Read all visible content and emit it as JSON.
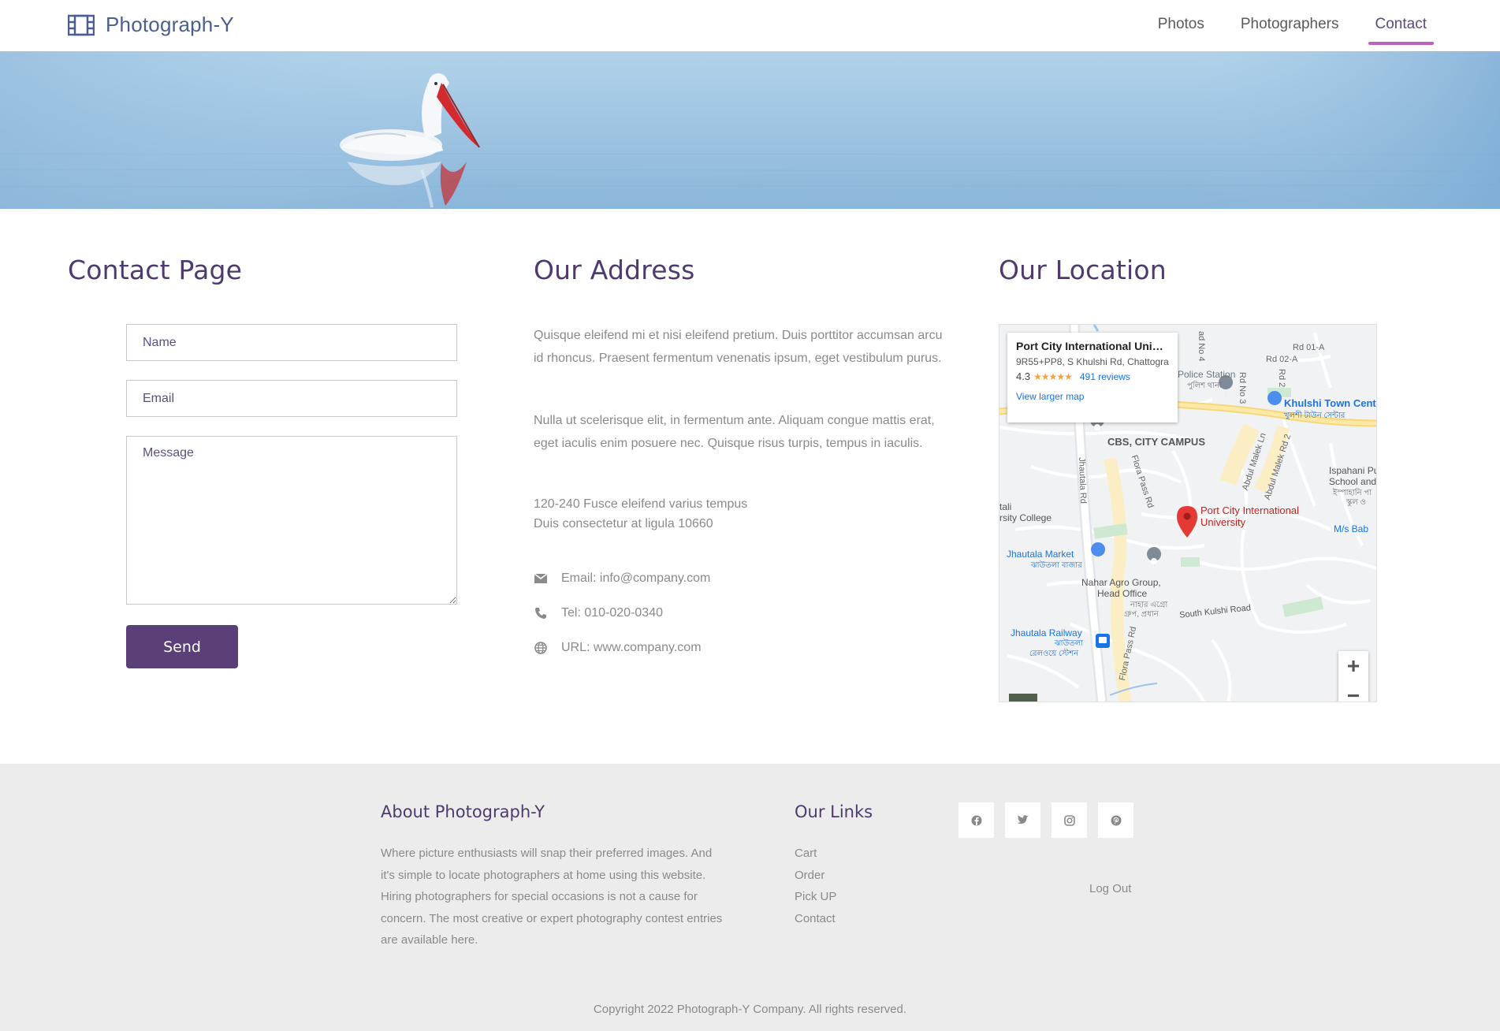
{
  "navbar": {
    "brand": "Photograph-Y",
    "brand_icon": "film-icon",
    "links": [
      {
        "label": "Photos"
      },
      {
        "label": "Photographers"
      },
      {
        "label": "Contact",
        "active": true
      }
    ],
    "active_color": "#b962c0"
  },
  "contact": {
    "title": "Contact Page",
    "name_placeholder": "Name",
    "email_placeholder": "Email",
    "message_placeholder": "Message",
    "send_label": "Send",
    "button_color": "#5a3f78"
  },
  "address": {
    "title": "Our Address",
    "paragraph1": "Quisque eleifend mi et nisi eleifend pretium. Duis porttitor accumsan arcu id rhoncus. Praesent fermentum venenatis ipsum, eget vestibulum purus.",
    "paragraph2": "Nulla ut scelerisque elit, in fermentum ante. Aliquam congue mattis erat, eget iaculis enim posuere nec. Quisque risus turpis, tempus in iaculis.",
    "line1": "120-240 Fusce eleifend varius tempus",
    "line2": "Duis consectetur at ligula 10660",
    "email": "Email: info@company.com",
    "tel": "Tel: 010-020-0340",
    "url": "URL: www.company.com"
  },
  "location": {
    "title": "Our Location",
    "card_title": "Port City International Univers...",
    "card_address": "9R55+PP8, S Khulshi Rd, Chattogram",
    "card_rating": "4.3",
    "card_stars": "★★★★★",
    "card_reviews": "491 reviews",
    "card_link": "View larger map",
    "zoom_in": "+",
    "zoom_out": "−",
    "labels": {
      "police": "Police Station",
      "police_bn": "পুলিশ থানা",
      "rd01a": "Rd 01-A",
      "rd02a": "Rd 02-A",
      "rd_no4": "ad No 4",
      "rd_no3": "Rd No 3",
      "rd2": "Rd 2",
      "khulshi": "Khulshi Town Cent",
      "khulshi_bn": "খুলশী টাউন সেন্টার",
      "cbs": "CBS, CITY CAMPUS",
      "abdul1": "Abdul Malek Ln",
      "abdul2": "Abdul Malek Rd 2",
      "ispahani1": "Ispahani Pu",
      "ispahani2": "School and Col",
      "ispahani_bn1": "ইস্পাহানি পা",
      "ispahani_bn2": "স্কুল ও",
      "jhautala_rd": "Jhautala Rd",
      "flora1": "Flora Pass Rd",
      "college1": "tali",
      "college2": "rsity College",
      "port1": "Port City International",
      "port2": "University",
      "msbab": "M/s Bab",
      "market": "Jhautala Market",
      "market_bn": "ঝাউতলা বাজার",
      "nahar1": "Nahar Agro Group,",
      "nahar2": "Head Office",
      "nahar_bn1": "নাহার এগ্রো",
      "nahar_bn2": "গ্রুপ, প্রধান",
      "south_kulshi": "South Kulshi Road",
      "railway": "Jhautala Railway",
      "railway_bn1": "ঝাউতলা",
      "railway_bn2": "রেলওয়ে স্টেশন",
      "flora2": "Flora Pass Rd"
    }
  },
  "footer": {
    "about_title": "About Photograph-Y",
    "about_text": "Where picture enthusiasts will snap their preferred images. And it's simple to locate photographers at home using this website. Hiring photographers for special occasions is not a cause for concern. The most creative or expert photography contest entries are available here.",
    "links_title": "Our Links",
    "links": [
      {
        "label": "Cart"
      },
      {
        "label": "Order"
      },
      {
        "label": "Pick UP"
      },
      {
        "label": "Contact"
      }
    ],
    "social": [
      "facebook-icon",
      "twitter-icon",
      "instagram-icon",
      "pinterest-icon"
    ],
    "logout": "Log Out",
    "copyright": "Copyright 2022 Photograph-Y Company. All rights reserved."
  }
}
